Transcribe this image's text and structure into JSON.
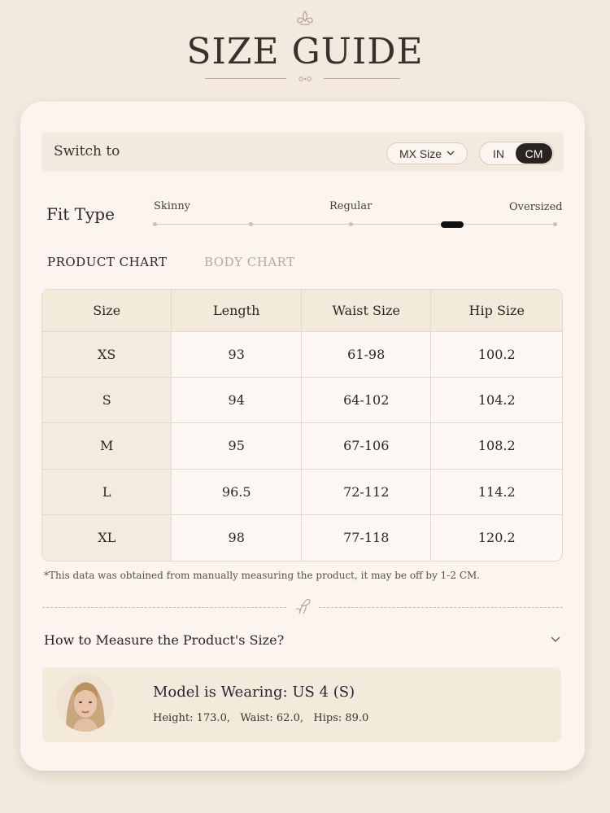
{
  "page": {
    "title": "SIZE GUIDE"
  },
  "switch": {
    "label": "Switch to",
    "region_select": "MX Size",
    "unit_in": "IN",
    "unit_cm": "CM",
    "selected_unit": "CM"
  },
  "fit": {
    "label": "Fit Type",
    "options": [
      "Skinny",
      "Regular",
      "Oversized"
    ],
    "level": 0.75
  },
  "tabs": {
    "product": "PRODUCT CHART",
    "body": "BODY CHART",
    "active": "PRODUCT CHART"
  },
  "table": {
    "headers": [
      "Size",
      "Length",
      "Waist Size",
      "Hip Size"
    ],
    "rows": [
      [
        "XS",
        "93",
        "61-98",
        "100.2"
      ],
      [
        "S",
        "94",
        "64-102",
        "104.2"
      ],
      [
        "M",
        "95",
        "67-106",
        "108.2"
      ],
      [
        "L",
        "96.5",
        "72-112",
        "114.2"
      ],
      [
        "XL",
        "98",
        "77-118",
        "120.2"
      ]
    ]
  },
  "note": "*This data was obtained from manually measuring the product, it may be off by 1-2 CM.",
  "measure": {
    "title": "How to Measure the Product's Size?"
  },
  "model": {
    "wearing": "Model is Wearing: US 4 (S)",
    "measurements": "Height: 173.0,   Waist: 62.0,   Hips: 89.0"
  },
  "colors": {
    "background": "#f3e9df",
    "card": "#fbf4ef",
    "accent_dark": "#2a2420",
    "header_fill": "#f4eadc"
  },
  "icons": {
    "header_ornament": "fleur-ornament-icon",
    "divider_mark": "script-monogram-icon",
    "select_chevron": "chevron-down-icon",
    "measure_chevron": "chevron-down-icon"
  }
}
